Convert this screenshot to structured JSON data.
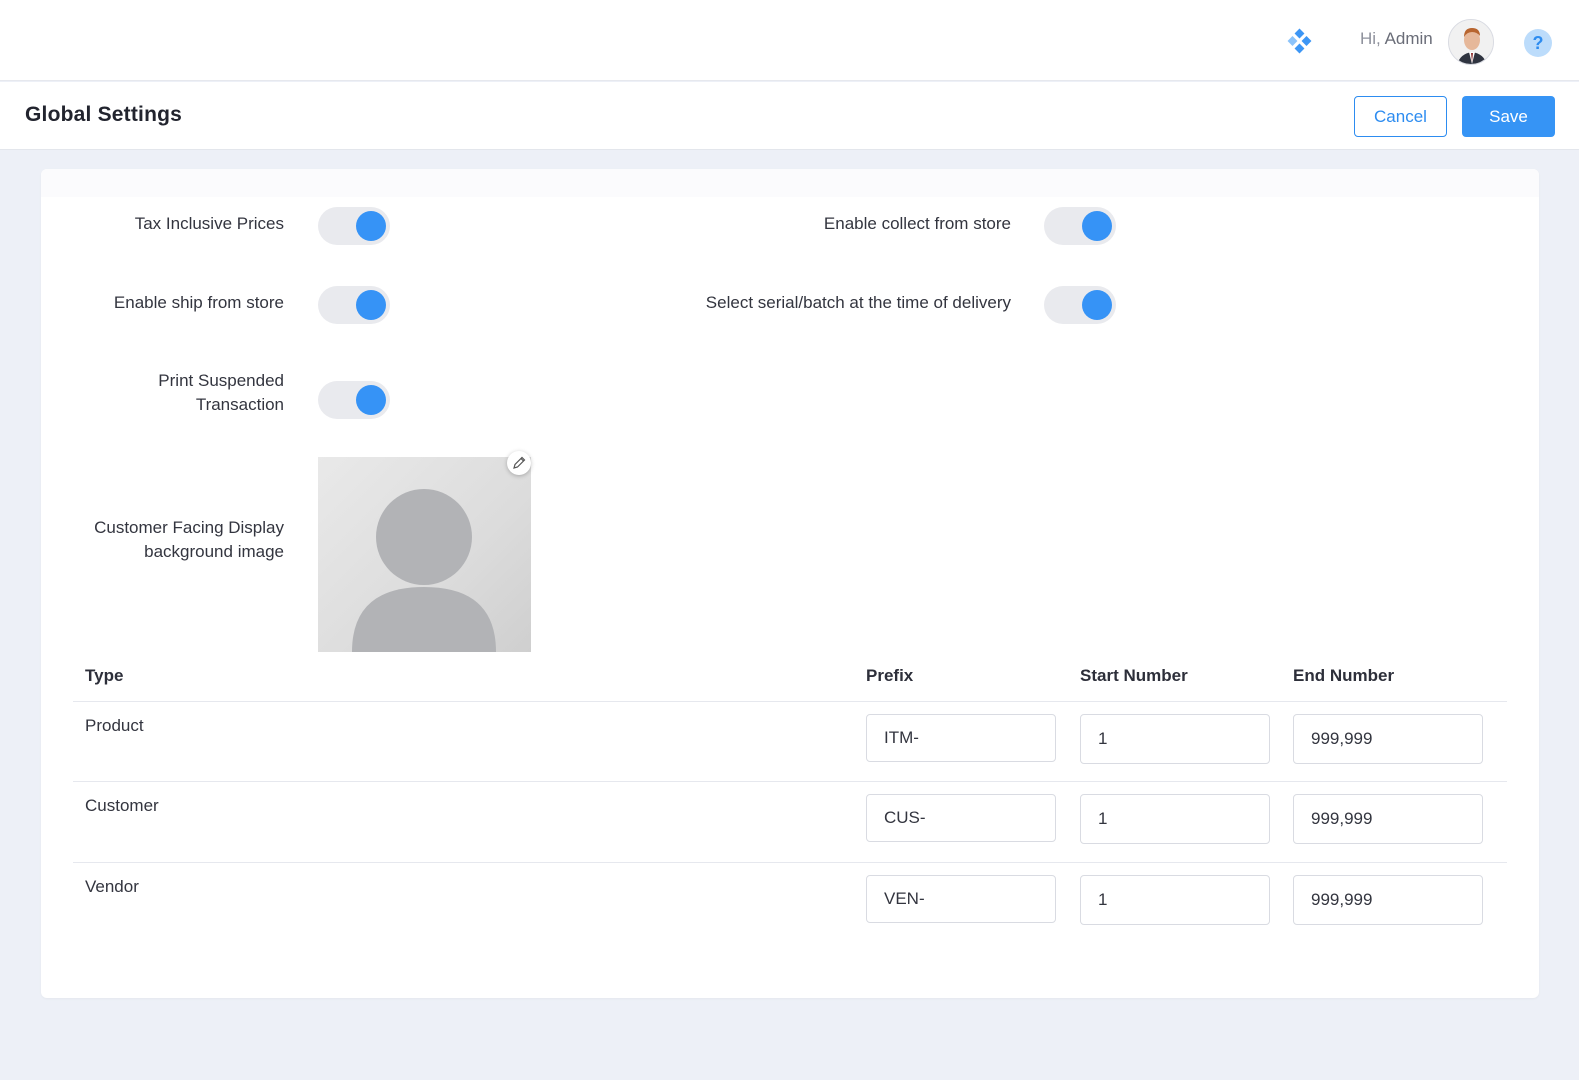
{
  "topbar": {
    "greeting_prefix": "Hi,",
    "user_name": "Admin",
    "help_glyph": "?",
    "icons": [
      "apps-icon",
      "avatar",
      "help-icon"
    ]
  },
  "page": {
    "title": "Global Settings",
    "cancel_label": "Cancel",
    "save_label": "Save"
  },
  "settings": {
    "tax_inclusive": {
      "label": "Tax Inclusive Prices",
      "on": true
    },
    "collect_from_store": {
      "label": "Enable collect from store",
      "on": true
    },
    "ship_from_store": {
      "label": "Enable ship from store",
      "on": true
    },
    "serial_batch": {
      "label": "Select serial/batch at the time of delivery",
      "on": true
    },
    "print_suspended": {
      "label_line1": "Print Suspended",
      "label_line2": "Transaction",
      "on": true
    },
    "cfd_image": {
      "label_line1": "Customer Facing Display",
      "label_line2": "background image"
    }
  },
  "table": {
    "headers": {
      "type": "Type",
      "prefix": "Prefix",
      "start": "Start Number",
      "end": "End Number"
    },
    "rows": [
      {
        "type": "Product",
        "prefix": "ITM-",
        "start": "1",
        "end": "999,999"
      },
      {
        "type": "Customer",
        "prefix": "CUS-",
        "start": "1",
        "end": "999,999"
      },
      {
        "type": "Vendor",
        "prefix": "VEN-",
        "start": "1",
        "end": "999,999"
      }
    ]
  },
  "colors": {
    "accent": "#3694f5",
    "toggle_track": "#e9eaee",
    "background": "#edf0f7"
  }
}
